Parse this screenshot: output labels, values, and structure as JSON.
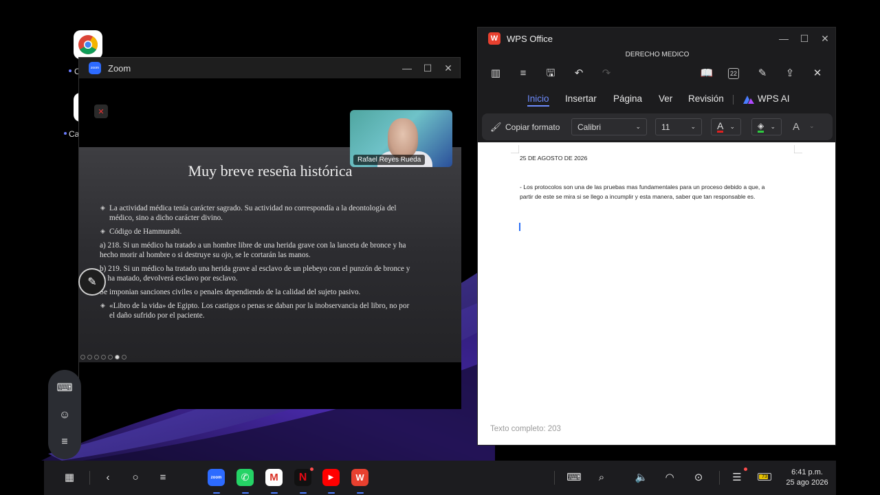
{
  "desktop": {
    "icons": [
      {
        "label": "C",
        "name": "Chrome"
      },
      {
        "label": "Ca",
        "name": "Calendar"
      }
    ]
  },
  "zoom": {
    "window_title": "Zoom",
    "logo_text": "zoom",
    "participant_name": "Rafael Reyes Rueda",
    "slide": {
      "title": "Muy breve reseña histórica",
      "lines": [
        "La actividad médica tenía carácter sagrado. Su actividad no correspondía a la deontología del",
        "médico, sino a dicho carácter divino.",
        "Código de Hammurabi.",
        "a) 218. Si un médico ha tratado a un hombre libre de una herida grave con la lanceta de bronce y ha",
        "hecho morir al hombre o si destruye su ojo, se le cortarán las manos.",
        "b) 219. Si un médico ha tratado una herida grave al esclavo de un plebeyo con el punzón de bronce y",
        "lo ha matado, devolverá esclavo por esclavo.",
        "Se imponian sanciones civiles o penales dependiendo de la calidad del sujeto pasivo.",
        "«Libro de la vida» de Egipto. Los castigos o penas se daban por la inobservancia del libro, no por",
        "el daño sufrido por el paciente."
      ]
    }
  },
  "wps": {
    "window_title": "WPS Office",
    "logo_text": "W",
    "document_title": "DERECHO MEDICO",
    "tabs": [
      "Inicio",
      "Insertar",
      "Página",
      "Ver",
      "Revisión",
      "WPS AI"
    ],
    "active_tab": "Inicio",
    "toolbar": {
      "copy_format": "Copiar formato",
      "font": "Calibri",
      "size": "11",
      "iconbar_badge": "22"
    },
    "document": {
      "date": "25 DE AGOSTO DE 2026",
      "paragraph_line1": "- Los protocolos son una de las pruebas mas fundamentales para un proceso debido a que, a",
      "paragraph_line2": "partir de este se mira si se llego  a incumplir y  esta manera, saber que tan responsable es."
    },
    "status": "Texto completo: 203"
  },
  "taskbar": {
    "apps": [
      {
        "name": "zoom",
        "label": "zoom",
        "color": "#2d6bff"
      },
      {
        "name": "whatsapp",
        "label": "",
        "color": "#25d366"
      },
      {
        "name": "gmail",
        "label": "M",
        "color": "#ffffff"
      },
      {
        "name": "netflix",
        "label": "N",
        "color": "#111111"
      },
      {
        "name": "youtube",
        "label": "",
        "color": "#ff0000"
      },
      {
        "name": "wps",
        "label": "W",
        "color": "#e8402f"
      }
    ],
    "battery": "73",
    "time": "6:41 p.m.",
    "date": "25 ago 2026"
  }
}
